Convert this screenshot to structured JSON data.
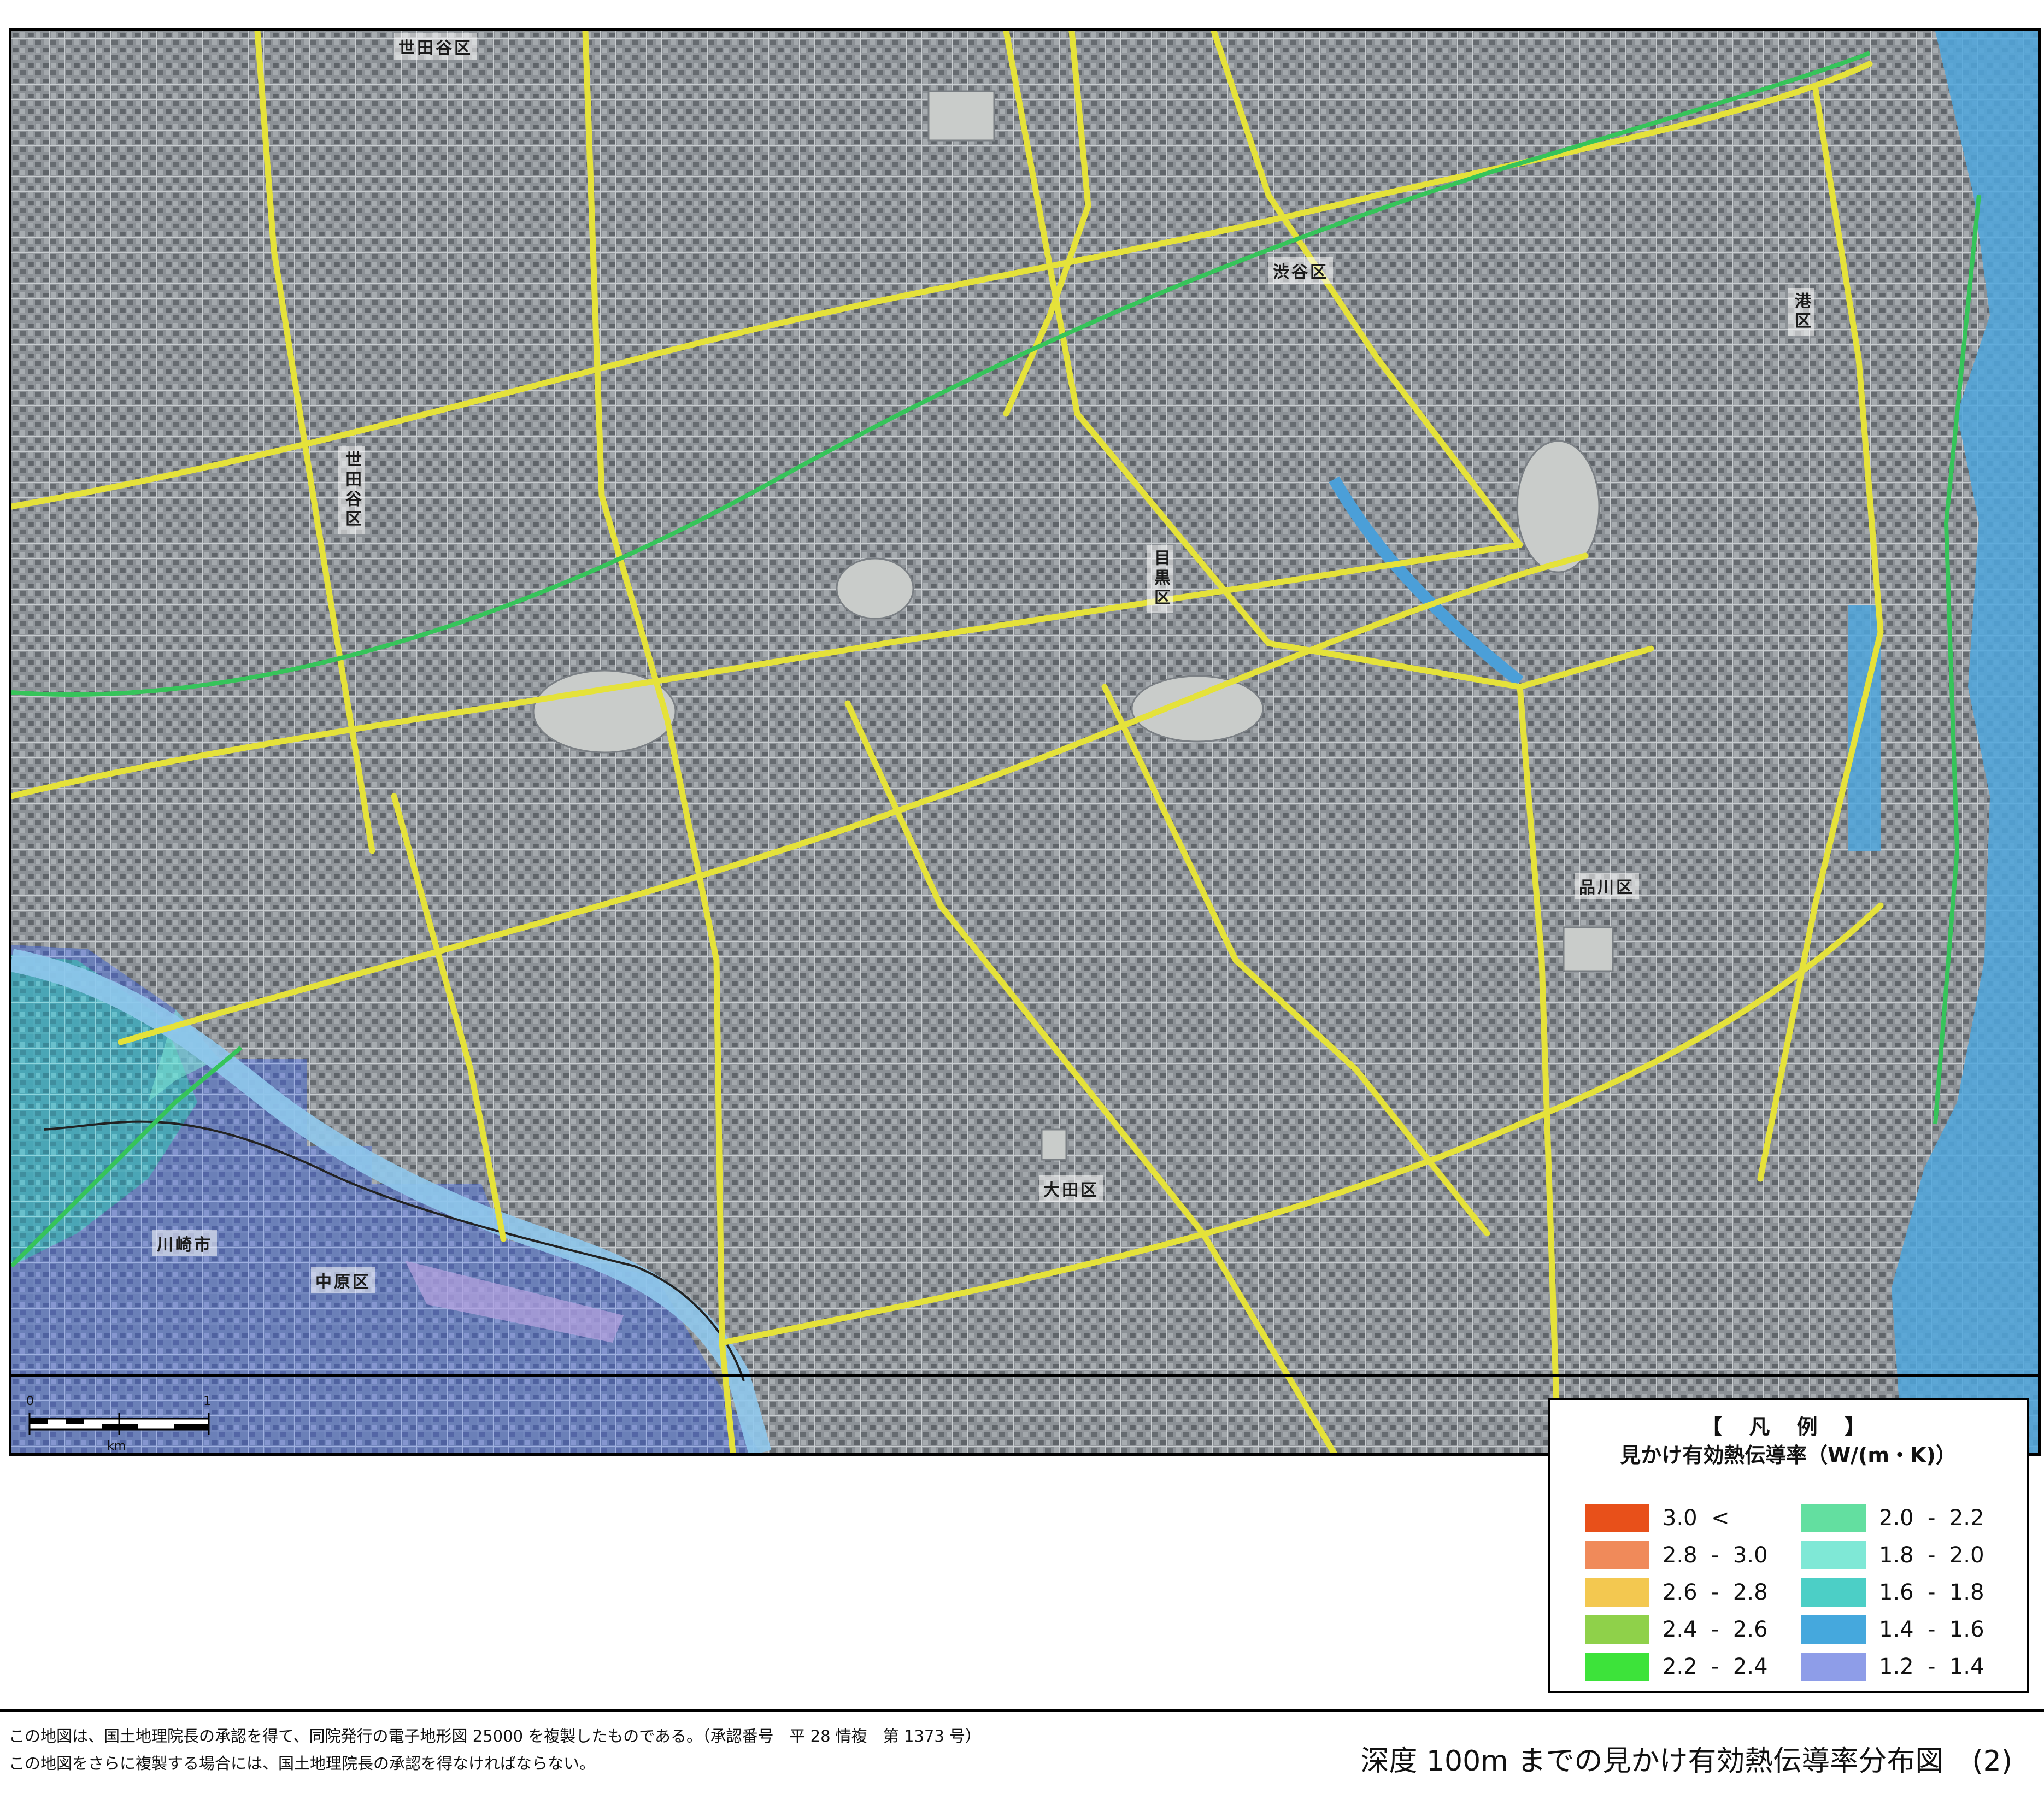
{
  "map": {
    "wards": [
      {
        "id": "setagaya-top",
        "label": "世田谷区"
      },
      {
        "id": "setagaya",
        "label": "世田谷区"
      },
      {
        "id": "shibuya",
        "label": "渋谷区"
      },
      {
        "id": "minato",
        "label": "港区"
      },
      {
        "id": "meguro",
        "label": "目黒区"
      },
      {
        "id": "shinagawa",
        "label": "品川区"
      },
      {
        "id": "ota",
        "label": "大田区"
      },
      {
        "id": "kawasaki",
        "label": "川崎市"
      },
      {
        "id": "nakahara",
        "label": "中原区"
      }
    ],
    "scale": {
      "zero": "0",
      "one": "1",
      "unit": "km"
    }
  },
  "legend": {
    "heading": "【 凡 例 】",
    "subtitle": "見かけ有効熱伝導率（W/(m・K)）",
    "items": [
      {
        "label": "3.0  <",
        "color": "#e8501a"
      },
      {
        "label": "2.8  -  3.0",
        "color": "#f08a5a"
      },
      {
        "label": "2.6  -  2.8",
        "color": "#f3c850"
      },
      {
        "label": "2.4  -  2.6",
        "color": "#8fd14a"
      },
      {
        "label": "2.2  -  2.4",
        "color": "#3de33a"
      },
      {
        "label": "2.0  -  2.2",
        "color": "#63dfa0"
      },
      {
        "label": "1.8  -  2.0",
        "color": "#7fe8d6"
      },
      {
        "label": "1.6  -  1.8",
        "color": "#4ccfc6"
      },
      {
        "label": "1.4  -  1.6",
        "color": "#45a8dd"
      },
      {
        "label": "1.2  -  1.4",
        "color": "#8e9de8"
      }
    ]
  },
  "credit": {
    "line1": "この地図は、国土地理院長の承認を得て、同院発行の電子地形図 25000 を複製したものである。（承認番号　平 28 情複　第 1373 号）",
    "line2": "この地図をさらに複製する場合には、国土地理院長の承認を得なければならない。"
  },
  "figure_title": "深度 100m までの見かけ有効熱伝導率分布図　(2)"
}
